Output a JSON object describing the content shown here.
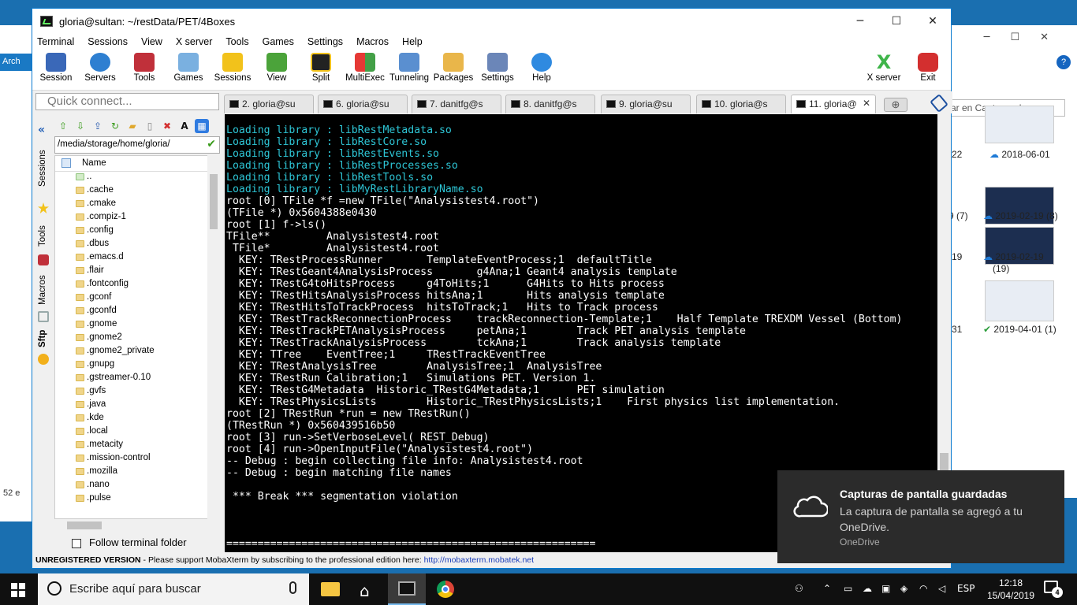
{
  "window": {
    "title": "gloria@sultan: ~/restData/PET/4Boxes",
    "minimize": "─",
    "maximize": "☐",
    "close": "✕"
  },
  "menu": [
    "Terminal",
    "Sessions",
    "View",
    "X server",
    "Tools",
    "Games",
    "Settings",
    "Macros",
    "Help"
  ],
  "toolbar": {
    "items": [
      "Session",
      "Servers",
      "Tools",
      "Games",
      "Sessions",
      "View",
      "Split",
      "MultiExec",
      "Tunneling",
      "Packages",
      "Settings",
      "Help"
    ],
    "xserver": "X server",
    "exit": "Exit"
  },
  "quick_connect": {
    "placeholder": "Quick connect..."
  },
  "tabs": [
    {
      "label": "2. gloria@su"
    },
    {
      "label": "6. gloria@su"
    },
    {
      "label": "7. danitfg@s"
    },
    {
      "label": "8. danitfg@s"
    },
    {
      "label": "9. gloria@su"
    },
    {
      "label": "10. gloria@s"
    },
    {
      "label": "11. gloria@"
    }
  ],
  "side_tabs": [
    "Sessions",
    "Tools",
    "Macros",
    "Sftp"
  ],
  "sftp": {
    "path": "/media/storage/home/gloria/",
    "column_name": "Name",
    "files": [
      "..",
      ".cache",
      ".cmake",
      ".compiz-1",
      ".config",
      ".dbus",
      ".emacs.d",
      ".flair",
      ".fontconfig",
      ".gconf",
      ".gconfd",
      ".gnome",
      ".gnome2",
      ".gnome2_private",
      ".gnupg",
      ".gstreamer-0.10",
      ".gvfs",
      ".java",
      ".kde",
      ".local",
      ".metacity",
      ".mission-control",
      ".mozilla",
      ".nano",
      ".pulse"
    ],
    "follow_label": "Follow terminal folder"
  },
  "terminal_lines": [
    {
      "pre": "Loading library : libRestMetadata.so",
      "cls": "cy"
    },
    {
      "pre": "Loading library : libRestCore.so",
      "cls": "cy"
    },
    {
      "pre": "Loading library : libRestEvents.so",
      "cls": "cy"
    },
    {
      "pre": "Loading library : libRestProcesses.so",
      "cls": "cy"
    },
    {
      "pre": "Loading library : libRestTools.so",
      "cls": "cy"
    },
    {
      "pre": "Loading library : libMyRestLibraryName.so",
      "cls": "cy"
    },
    {
      "pre": "root [0] TFile *f =new TFile(\"Analysistest4.root\")",
      "cls": ""
    },
    {
      "pre": "(TFile *) 0x5604388e0430",
      "cls": ""
    },
    {
      "pre": "root [1] f->ls()",
      "cls": ""
    },
    {
      "pre": "TFile**         Analysistest4.root",
      "cls": ""
    },
    {
      "pre": " TFile*         Analysistest4.root",
      "cls": ""
    },
    {
      "pre": "  KEY: TRestProcessRunner       TemplateEventProcess;1  defaultTitle",
      "cls": ""
    },
    {
      "pre": "  KEY: TRestGeant4AnalysisProcess       g4Ana;1 Geant4 analysis template",
      "cls": ""
    },
    {
      "pre": "  KEY: TRestG4toHitsProcess     g4ToHits;1      G4Hits to Hits process",
      "cls": ""
    },
    {
      "pre": "  KEY: TRestHitsAnalysisProcess hitsAna;1       Hits analysis template",
      "cls": ""
    },
    {
      "pre": "  KEY: TRestHitsToTrackProcess  hitsToTrack;1   Hits to Track process",
      "cls": ""
    },
    {
      "pre": "  KEY: TRestTrackReconnectionProcess    trackReconnection-Template;1    Half Template TREXDM Vessel (Bottom)",
      "cls": ""
    },
    {
      "pre": "  KEY: TRestTrackPETAnalysisProcess     petAna;1        Track PET analysis template",
      "cls": ""
    },
    {
      "pre": "  KEY: TRestTrackAnalysisProcess        tckAna;1        Track analysis template",
      "cls": ""
    },
    {
      "pre": "  KEY: TTree    EventTree;1     TRestTrackEventTree",
      "cls": ""
    },
    {
      "pre": "  KEY: TRestAnalysisTree        AnalysisTree;1  AnalysisTree",
      "cls": ""
    },
    {
      "pre": "  KEY: TRestRun Calibration;1   Simulations PET. Version 1.",
      "cls": ""
    },
    {
      "pre": "  KEY: TRestG4Metadata  Historic_TRestG4Metadata;1      PET simulation",
      "cls": ""
    },
    {
      "pre": "  KEY: TRestPhysicsLists        Historic_TRestPhysicsLists;1    First physics list implementation.",
      "cls": ""
    },
    {
      "pre": "root [2] TRestRun *run = new TRestRun()",
      "cls": ""
    },
    {
      "pre": "(TRestRun *) 0x560439516b50",
      "cls": ""
    },
    {
      "pre": "root [3] run->SetVerboseLevel( REST_Debug)",
      "cls": ""
    },
    {
      "pre": "root [4] run->OpenInputFile(\"Analysistest4.root\")",
      "cls": ""
    },
    {
      "pre": "-- Debug : begin collecting file info: Analysistest4.root",
      "cls": ""
    },
    {
      "pre": "-- Debug : begin matching file names",
      "cls": ""
    },
    {
      "pre": "",
      "cls": ""
    },
    {
      "pre": " *** Break *** segmentation violation",
      "cls": ""
    },
    {
      "pre": "",
      "cls": ""
    },
    {
      "pre": "",
      "cls": ""
    },
    {
      "pre": "",
      "cls": ""
    },
    {
      "pre": "===========================================================",
      "cls": ""
    }
  ],
  "statusbar": {
    "unregistered": "UNREGISTERED VERSION",
    "message": "  -  Please support MobaXterm by subscribing to the professional edition here:  ",
    "link": "http://mobaxterm.mobatek.net"
  },
  "toast": {
    "title": "Capturas de pantalla guardadas",
    "body": "La captura de pantalla se agregó a tu OneDrive.",
    "source": "OneDrive"
  },
  "bg_explorer": {
    "search_placeholder": "ar en Capturas de p...",
    "captions": [
      "-22",
      "2018-06-01",
      "9 (7)",
      "2019-02-19 (8)",
      "-19",
      "2019-02-19",
      "(19)",
      "-31",
      "2019-04-01 (1)"
    ],
    "left_label": "Arch",
    "left_count": "52 e"
  },
  "taskbar": {
    "search_placeholder": "Escribe aquí para buscar",
    "language": "ESP",
    "time": "12:18",
    "date": "15/04/2019",
    "notifications": "4"
  }
}
